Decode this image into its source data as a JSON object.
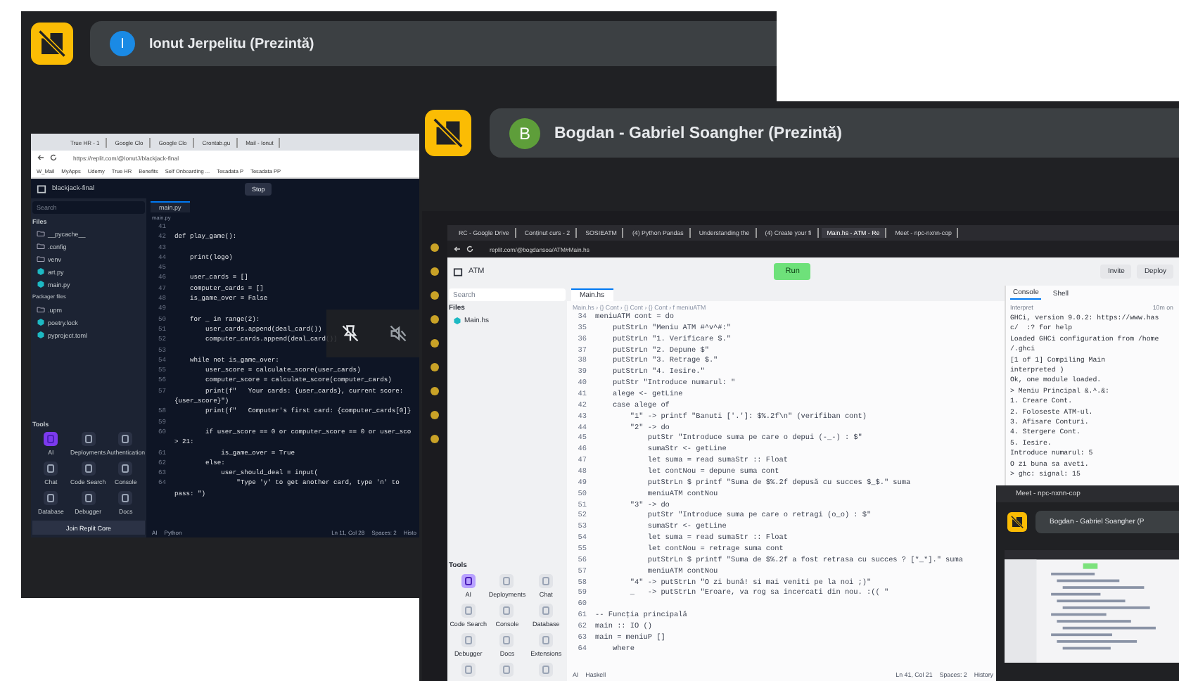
{
  "meet_tiles": [
    {
      "participant": "Ionut Jerpelitu (Prezintă)",
      "avatar": "I",
      "color": "#1a8ae5",
      "kind": "dark",
      "muted": true,
      "browser": {
        "tabs": [
          {
            "title": "True HR - 1",
            "selected": false
          },
          {
            "title": "Google Clo",
            "selected": false
          },
          {
            "title": "Google Clo",
            "selected": false
          },
          {
            "title": "Crontab.gu",
            "selected": false
          },
          {
            "title": "Mail - Ionut",
            "selected": false
          }
        ],
        "url": "https://replit.com/@IonutJ/blackjack-final",
        "bookmarks": [
          "W_Mail",
          "MyApps",
          "Udemy",
          "True HR",
          "Benefits",
          "Self Onboarding ...",
          "Tesadata P",
          "Tesadata PP"
        ]
      },
      "ide": {
        "project": "blackjack-final",
        "run_button": "Stop",
        "search": "Search",
        "files_heading": "Files",
        "files": [
          {
            "name": "__pycache__",
            "kind": "folder"
          },
          {
            "name": ".config",
            "kind": "folder"
          },
          {
            "name": "venv",
            "kind": "folder"
          },
          {
            "name": "art.py",
            "kind": "file"
          },
          {
            "name": "main.py",
            "kind": "file"
          }
        ],
        "packager_heading": "Packager files",
        "packager_files": [
          {
            "name": ".upm",
            "kind": "folder"
          },
          {
            "name": "poetry.lock",
            "kind": "file"
          },
          {
            "name": "pyproject.toml",
            "kind": "file"
          }
        ],
        "tools_heading": "Tools",
        "tools": [
          {
            "label": "AI",
            "selected": true
          },
          {
            "label": "Deployments",
            "selected": false
          },
          {
            "label": "Authentication",
            "selected": false
          },
          {
            "label": "Chat",
            "selected": false
          },
          {
            "label": "Code Search",
            "selected": false
          },
          {
            "label": "Console",
            "selected": false
          },
          {
            "label": "Database",
            "selected": false
          },
          {
            "label": "Debugger",
            "selected": false
          },
          {
            "label": "Docs",
            "selected": false
          }
        ],
        "join_banner": "Join Replit Core",
        "editor_tab": "main.py",
        "breadcrumb": "main.py",
        "lines": [
          {
            "n": "41"
          },
          {
            "n": "42",
            "text": "def play_game():"
          },
          {
            "n": "43"
          },
          {
            "n": "44",
            "text": "    print(logo)"
          },
          {
            "n": "45"
          },
          {
            "n": "46",
            "text": "    user_cards = []"
          },
          {
            "n": "47",
            "text": "    computer_cards = []"
          },
          {
            "n": "48",
            "text": "    is_game_over = False"
          },
          {
            "n": "49"
          },
          {
            "n": "50",
            "text": "    for _ in range(2):"
          },
          {
            "n": "51",
            "text": "        user_cards.append(deal_card())"
          },
          {
            "n": "52",
            "text": "        computer_cards.append(deal_card())"
          },
          {
            "n": "53"
          },
          {
            "n": "54",
            "text": "    while not is_game_over:"
          },
          {
            "n": "55",
            "text": "        user_score = calculate_score(user_cards)"
          },
          {
            "n": "56",
            "text": "        computer_score = calculate_score(computer_cards)"
          },
          {
            "n": "57",
            "text": "        print(f\"   Your cards: {user_cards}, current score:"
          },
          {
            "text": "{user_score}\")"
          },
          {
            "n": "58",
            "text": "        print(f\"   Computer's first card: {computer_cards[0]}"
          },
          {
            "n": "59"
          },
          {
            "n": "60",
            "text": "        if user_score == 0 or computer_score == 0 or user_sco"
          },
          {
            "text": "> 21:"
          },
          {
            "n": "61",
            "text": "            is_game_over = True"
          },
          {
            "n": "62",
            "text": "        else:"
          },
          {
            "n": "63",
            "text": "            user_should_deal = input("
          },
          {
            "n": "64",
            "text": "                \"Type 'y' to get another card, type 'n' to"
          },
          {
            "text": "pass: \")"
          }
        ],
        "status": [
          "AI",
          "Python",
          "Ln 11, Col 28",
          "Spaces: 2",
          "Histo"
        ]
      }
    },
    {
      "participant": "Bogdan - Gabriel Soangher (Prezintă)",
      "avatar": "B",
      "color": "#5e9e3a",
      "kind": "light",
      "muted": false,
      "browser": {
        "tabs": [
          {
            "title": "RC - Google Drive",
            "selected": false
          },
          {
            "title": "Conținut curs - 2",
            "selected": false
          },
          {
            "title": "SOSIEATM",
            "selected": false
          },
          {
            "title": "(4) Python Pandas",
            "selected": false
          },
          {
            "title": "Understanding the",
            "selected": false
          },
          {
            "title": "(4) Create your fi",
            "selected": false
          },
          {
            "title": "Main.hs - ATM - Re",
            "selected": true
          },
          {
            "title": "Meet - npc-nxnn-cop",
            "selected": false
          }
        ],
        "url": "replit.com/@bogdansoa/ATM#Main.hs"
      },
      "ide": {
        "project": "ATM",
        "run_button": "Run",
        "header_buttons": [
          "Invite",
          "Deploy"
        ],
        "search": "Search",
        "files_heading": "Files",
        "files": [
          {
            "name": "Main.hs",
            "kind": "file"
          }
        ],
        "tools_heading": "Tools",
        "tools": [
          {
            "label": "AI",
            "selected": true
          },
          {
            "label": "Deployments",
            "selected": false
          },
          {
            "label": "Chat",
            "selected": false
          },
          {
            "label": "Code Search",
            "selected": false
          },
          {
            "label": "Console",
            "selected": false
          },
          {
            "label": "Database",
            "selected": false
          },
          {
            "label": "Debugger",
            "selected": false
          },
          {
            "label": "Docs",
            "selected": false
          },
          {
            "label": "Extensions",
            "selected": false
          },
          {
            "selected": false
          },
          {
            "selected": false
          },
          {
            "selected": false
          }
        ],
        "editor_tab": "Main.hs",
        "breadcrumb": "Main.hs › {} Cont › {} Cont › {} Cont › f meniuATM",
        "lines": [
          {
            "n": "34",
            "text": "meniuATM cont = do"
          },
          {
            "n": "35",
            "text": "    putStrLn \"Meniu ATM #^v^#:\""
          },
          {
            "n": "36",
            "text": "    putStrLn \"1. Verificare $.\""
          },
          {
            "n": "37",
            "text": "    putStrLn \"2. Depune $\""
          },
          {
            "n": "38",
            "text": "    putStrLn \"3. Retrage $.\""
          },
          {
            "n": "39",
            "text": "    putStrLn \"4. Iesire.\""
          },
          {
            "n": "40",
            "text": "    putStr \"Introduce numarul: \""
          },
          {
            "n": "41",
            "text": "    alege <- getLine"
          },
          {
            "n": "42",
            "text": "    case alege of"
          },
          {
            "n": "43",
            "text": "        \"1\" -> printf \"Banuti ['.']: $%.2f\\n\" (verifiban cont)"
          },
          {
            "n": "44",
            "text": "        \"2\" -> do"
          },
          {
            "n": "45",
            "text": "            putStr \"Introduce suma pe care o depui (-_-) : $\""
          },
          {
            "n": "46",
            "text": "            sumaStr <- getLine"
          },
          {
            "n": "47",
            "text": "            let suma = read sumaStr :: Float"
          },
          {
            "n": "48",
            "text": "            let contNou = depune suma cont"
          },
          {
            "n": "49",
            "text": "            putStrLn $ printf \"Suma de $%.2f depusă cu succes $_$.\" suma"
          },
          {
            "n": "50",
            "text": "            meniuATM contNou"
          },
          {
            "n": "51",
            "text": "        \"3\" -> do"
          },
          {
            "n": "52",
            "text": "            putStr \"Introduce suma pe care o retragi (o_o) : $\""
          },
          {
            "n": "53",
            "text": "            sumaStr <- getLine"
          },
          {
            "n": "54",
            "text": "            let suma = read sumaStr :: Float"
          },
          {
            "n": "55",
            "text": "            let contNou = retrage suma cont"
          },
          {
            "n": "56",
            "text": "            putStrLn $ printf \"Suma de $%.2f a fost retrasa cu succes ? [*_*].\" suma"
          },
          {
            "n": "57",
            "text": "            meniuATM contNou"
          },
          {
            "n": "58",
            "text": "        \"4\" -> putStrLn \"O zi bună! si mai veniti pe la noi ;)\""
          },
          {
            "n": "59",
            "text": "        _   -> putStrLn \"Eroare, va rog sa incercati din nou. :(( \""
          },
          {
            "n": "60"
          },
          {
            "n": "61",
            "text": "-- Funcția principală"
          },
          {
            "n": "62",
            "text": "main :: IO ()"
          },
          {
            "n": "63",
            "text": "main = meniuP []"
          },
          {
            "n": "64",
            "text": "    where"
          }
        ],
        "status": [
          "AI",
          "Haskell",
          "Ln 41, Col 21",
          "Spaces: 2",
          "History"
        ],
        "console": {
          "tabs": [
            {
              "title": "Console",
              "selected": true
            },
            {
              "title": "Shell",
              "selected": false
            }
          ],
          "run_label": "Interpret",
          "run_time": "10m on",
          "output": [
            "GHCi, version 9.0.2: https://www.has",
            "c/  :? for help",
            "Loaded GHCi configuration from /home",
            "/.ghci",
            "[1 of 1] Compiling Main",
            "interpreted )",
            "Ok, one module loaded.",
            "> Meniu Principal &.^.&:",
            "1. Creare Cont.",
            "2. Foloseste ATM-ul.",
            "3. Afisare Conturi.",
            "4. Stergere Cont.",
            "5. Iesire.",
            "Introduce numarul: 5",
            "O zi buna sa aveti.",
            "> ghc: signal: 15"
          ]
        },
        "mini_window": {
          "title": "Meet - npc-nxnn-cop",
          "participant": "Bogdan - Gabriel Soangher (P"
        }
      }
    }
  ]
}
